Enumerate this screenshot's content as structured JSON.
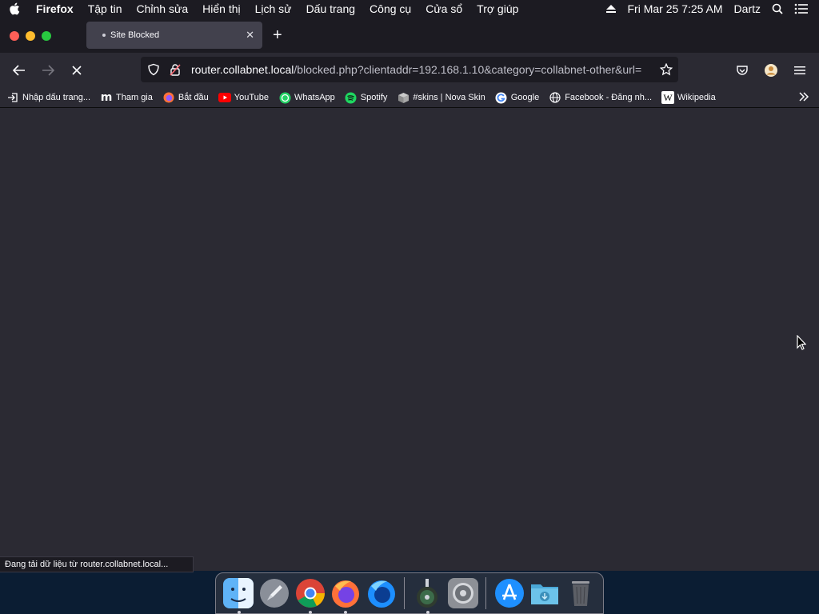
{
  "menubar": {
    "app_name": "Firefox",
    "items": [
      "Tập tin",
      "Chỉnh sửa",
      "Hiển thị",
      "Lịch sử",
      "Dấu trang",
      "Công cụ",
      "Cửa sổ",
      "Trợ giúp"
    ],
    "datetime": "Fri Mar 25  7:25 AM",
    "user": "Dartz"
  },
  "tab": {
    "title": "Site Blocked"
  },
  "urlbar": {
    "host": "router.collabnet.local",
    "path": "/blocked.php?clientaddr=192.168.1.10&category=collabnet-other&url="
  },
  "bookmarks": [
    {
      "label": "Nhập dấu trang...",
      "icon": "import-icon"
    },
    {
      "label": "Tham gia",
      "icon": "m-logo-icon"
    },
    {
      "label": "Bắt đầu",
      "icon": "firefox-icon"
    },
    {
      "label": "YouTube",
      "icon": "youtube-icon"
    },
    {
      "label": "WhatsApp",
      "icon": "whatsapp-icon"
    },
    {
      "label": "Spotify",
      "icon": "spotify-icon"
    },
    {
      "label": "#skins | Nova Skin",
      "icon": "cube-icon"
    },
    {
      "label": "Google",
      "icon": "google-icon"
    },
    {
      "label": "Facebook - Đăng nh...",
      "icon": "globe-icon"
    },
    {
      "label": "Wikipedia",
      "icon": "wikipedia-icon"
    }
  ],
  "status": {
    "text": "Đang tải dữ liệu từ router.collabnet.local..."
  },
  "dock": [
    "finder-icon",
    "launchpad-icon",
    "chrome-icon",
    "firefox-icon",
    "firefox-dev-icon",
    "disk-utility-icon",
    "system-preferences-icon",
    "app-store-icon",
    "downloads-folder-icon",
    "trash-icon"
  ],
  "colors": {
    "chrome_dark": "#1c1b22",
    "toolbar": "#2b2a33",
    "tab_selected": "#42414d"
  }
}
